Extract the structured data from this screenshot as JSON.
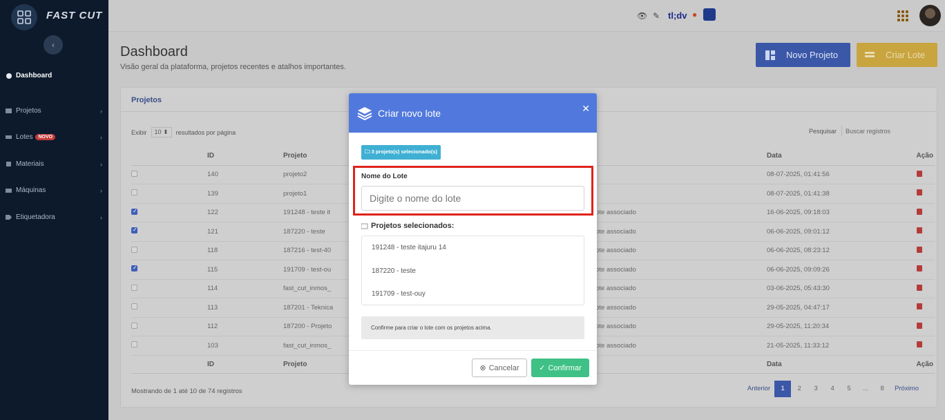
{
  "app": {
    "name": "FAST CUT"
  },
  "sidebar": {
    "items": [
      {
        "label": "Dashboard",
        "active": true
      },
      {
        "label": "Projetos"
      },
      {
        "label": "Lotes",
        "badge": "NOVO"
      },
      {
        "label": "Materiais"
      },
      {
        "label": "Máquinas"
      },
      {
        "label": "Etiquetadora"
      }
    ]
  },
  "topbar": {
    "tldv_label": "tl;dv"
  },
  "page": {
    "title": "Dashboard",
    "subtitle": "Visão geral da plataforma, projetos recentes e atalhos importantes.",
    "btn_novo": "Novo Projeto",
    "btn_criar": "Criar Lote"
  },
  "card": {
    "tab": "Projetos",
    "exibir": "Exibir",
    "per_page": "10",
    "per_page_suffix": "resultados por página",
    "pesquisar": "Pesquisar",
    "buscar_placeholder": "Buscar registros",
    "columns": {
      "id": "ID",
      "projeto": "Projeto",
      "data": "Data",
      "acao": "Ação"
    },
    "rows": [
      {
        "checked": false,
        "id": "140",
        "projeto": "projeto2",
        "status": "",
        "data": "08-07-2025, 01:41:56"
      },
      {
        "checked": false,
        "id": "139",
        "projeto": "projeto1",
        "status": "",
        "data": "08-07-2025, 01:41:38"
      },
      {
        "checked": true,
        "id": "122",
        "projeto": "191248 - teste it",
        "status": "lote associado",
        "data": "16-06-2025, 09:18:03"
      },
      {
        "checked": true,
        "id": "121",
        "projeto": "187220 - teste",
        "status": "lote associado",
        "data": "06-06-2025, 09:01:12"
      },
      {
        "checked": false,
        "id": "118",
        "projeto": "187216 - test-40",
        "status": "lote associado",
        "data": "06-06-2025, 08:23:12"
      },
      {
        "checked": true,
        "id": "115",
        "projeto": "191709 - test-ou",
        "status": "lote associado",
        "data": "06-06-2025, 09:09:26"
      },
      {
        "checked": false,
        "id": "114",
        "projeto": "fast_cut_inmos_",
        "status": "lote associado",
        "data": "03-06-2025, 05:43:30"
      },
      {
        "checked": false,
        "id": "113",
        "projeto": "187201 - Teknica",
        "status": "lote associado",
        "data": "29-05-2025, 04:47:17"
      },
      {
        "checked": false,
        "id": "112",
        "projeto": "187200 - Projeto",
        "status": "lote associado",
        "data": "29-05-2025, 11:20:34"
      },
      {
        "checked": false,
        "id": "103",
        "projeto": "fast_cut_inmos_",
        "status": "lote associado",
        "data": "21-05-2025, 11:33:12"
      }
    ],
    "showing": "Mostrando de 1 até 10 de 74 registros",
    "pager": {
      "prev": "Anterior",
      "pages": [
        "1",
        "2",
        "3",
        "4",
        "5",
        "...",
        "8"
      ],
      "next": "Próximo"
    }
  },
  "modal": {
    "title": "Criar novo lote",
    "badge": "3 projeto(s) selecionado(s)",
    "nome_label": "Nome do Lote",
    "nome_placeholder": "Digite o nome do lote",
    "proj_label": "Projetos selecionados:",
    "projects": [
      "191248 - teste itajuru 14",
      "187220 - teste",
      "191709 - test-ouy"
    ],
    "note": "Confirme para criar o lote com os projetos acima.",
    "cancel": "Cancelar",
    "confirm": "Confirmar"
  },
  "colors": {
    "modal_header": "#5179dd",
    "confirm": "#3fc186",
    "highlight": "#e0221c",
    "sidebar": "#0d1a2c"
  }
}
